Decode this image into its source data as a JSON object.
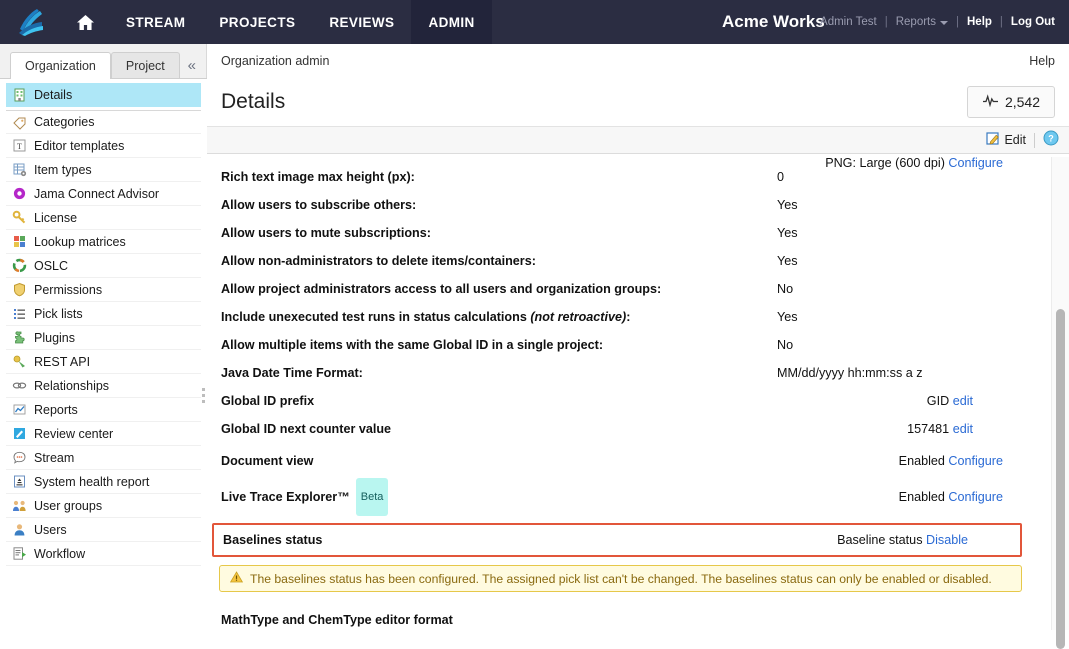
{
  "topnav": {
    "logo_icon": "jama-logo-icon",
    "home_icon": "home-icon",
    "items": [
      {
        "label": "STREAM",
        "active": false
      },
      {
        "label": "PROJECTS",
        "active": false
      },
      {
        "label": "REVIEWS",
        "active": false
      },
      {
        "label": "ADMIN",
        "active": true
      }
    ],
    "org_title": "Acme Works",
    "user": "Admin Test",
    "reports": "Reports",
    "help": "Help",
    "logout": "Log Out",
    "separator": "|",
    "bg_color": "#2b2d42",
    "active_bg_color": "#22243a"
  },
  "sidebar": {
    "tabs": [
      {
        "label": "Organization",
        "active": true
      },
      {
        "label": "Project",
        "active": false
      }
    ],
    "collapse_icon": "chevron-double-left-icon",
    "items": [
      {
        "label": "Details",
        "icon": "building-icon",
        "selected": true
      },
      {
        "label": "Categories",
        "icon": "tag-icon",
        "selected": false
      },
      {
        "label": "Editor templates",
        "icon": "text-template-icon",
        "selected": false
      },
      {
        "label": "Item types",
        "icon": "grid-gear-icon",
        "selected": false
      },
      {
        "label": "Jama Connect Advisor",
        "icon": "advisor-badge-icon",
        "selected": false
      },
      {
        "label": "License",
        "icon": "key-icon",
        "selected": false
      },
      {
        "label": "Lookup matrices",
        "icon": "matrix-icon",
        "selected": false
      },
      {
        "label": "OSLC",
        "icon": "oslc-ring-icon",
        "selected": false
      },
      {
        "label": "Permissions",
        "icon": "shield-icon",
        "selected": false
      },
      {
        "label": "Pick lists",
        "icon": "list-icon",
        "selected": false
      },
      {
        "label": "Plugins",
        "icon": "puzzle-icon",
        "selected": false
      },
      {
        "label": "REST API",
        "icon": "rest-api-icon",
        "selected": false
      },
      {
        "label": "Relationships",
        "icon": "link-chain-icon",
        "selected": false
      },
      {
        "label": "Reports",
        "icon": "chart-line-icon",
        "selected": false
      },
      {
        "label": "Review center",
        "icon": "review-pencil-icon",
        "selected": false
      },
      {
        "label": "Stream",
        "icon": "chat-bubble-icon",
        "selected": false
      },
      {
        "label": "System health report",
        "icon": "health-report-icon",
        "selected": false
      },
      {
        "label": "User groups",
        "icon": "users-group-icon",
        "selected": false
      },
      {
        "label": "Users",
        "icon": "user-icon",
        "selected": false
      },
      {
        "label": "Workflow",
        "icon": "workflow-doc-icon",
        "selected": false
      }
    ]
  },
  "main": {
    "breadcrumb": "Organization admin",
    "help_link": "Help",
    "page_title": "Details",
    "stat_pill": {
      "icon": "activity-pulse-icon",
      "value": "2,542"
    },
    "toolbar": {
      "edit_label": "Edit",
      "edit_icon": "edit-pencil-icon",
      "help_icon": "question-circle-icon"
    },
    "rows": [
      {
        "label": "Rich text image max height (px):",
        "value": "0",
        "align": "left"
      },
      {
        "label": "Allow users to subscribe others:",
        "value": "Yes",
        "align": "left"
      },
      {
        "label": "Allow users to mute subscriptions:",
        "value": "Yes",
        "align": "left"
      },
      {
        "label": "Allow non-administrators to delete items/containers:",
        "value": "Yes",
        "align": "left"
      },
      {
        "label": "Allow project administrators access to all users and organization groups:",
        "value": "No",
        "align": "left"
      },
      {
        "label": "Include unexecuted test runs in status calculations ",
        "label_em": "(not retroactive)",
        "label_tail": ":",
        "value": "Yes",
        "align": "left"
      },
      {
        "label": "Allow multiple items with the same Global ID in a single project:",
        "value": "No",
        "align": "left"
      },
      {
        "label": "Java Date Time Format:",
        "value": "MM/dd/yyyy hh:mm:ss a z",
        "align": "left"
      },
      {
        "label": "Global ID prefix",
        "value": "GID",
        "link": "edit",
        "align": "right"
      },
      {
        "label": "Global ID next counter value",
        "value": "157481",
        "link": "edit",
        "align": "right"
      },
      {
        "label": "Document view",
        "value": "Enabled",
        "link": "Configure",
        "align": "right"
      },
      {
        "label": "Live Trace Explorer™",
        "badge": "Beta",
        "value": "Enabled",
        "link": "Configure",
        "align": "right"
      }
    ],
    "highlight_row": {
      "label": "Baselines status",
      "value": "Baseline status",
      "link": "Disable",
      "border_color": "#e2563a"
    },
    "warning": {
      "icon": "warning-triangle-icon",
      "text": "The baselines status has been configured. The assigned pick list can't be changed. The baselines status can only be enabled or disabled.",
      "bg_color": "#fffbe0",
      "border_color": "#e6c84a",
      "text_color": "#8a6a10"
    },
    "last_row": {
      "label": "MathType and ChemType editor format",
      "value": "PNG: Large (600 dpi)",
      "link": "Configure"
    },
    "scrollbar": {
      "name": "vertical-scrollbar"
    }
  }
}
